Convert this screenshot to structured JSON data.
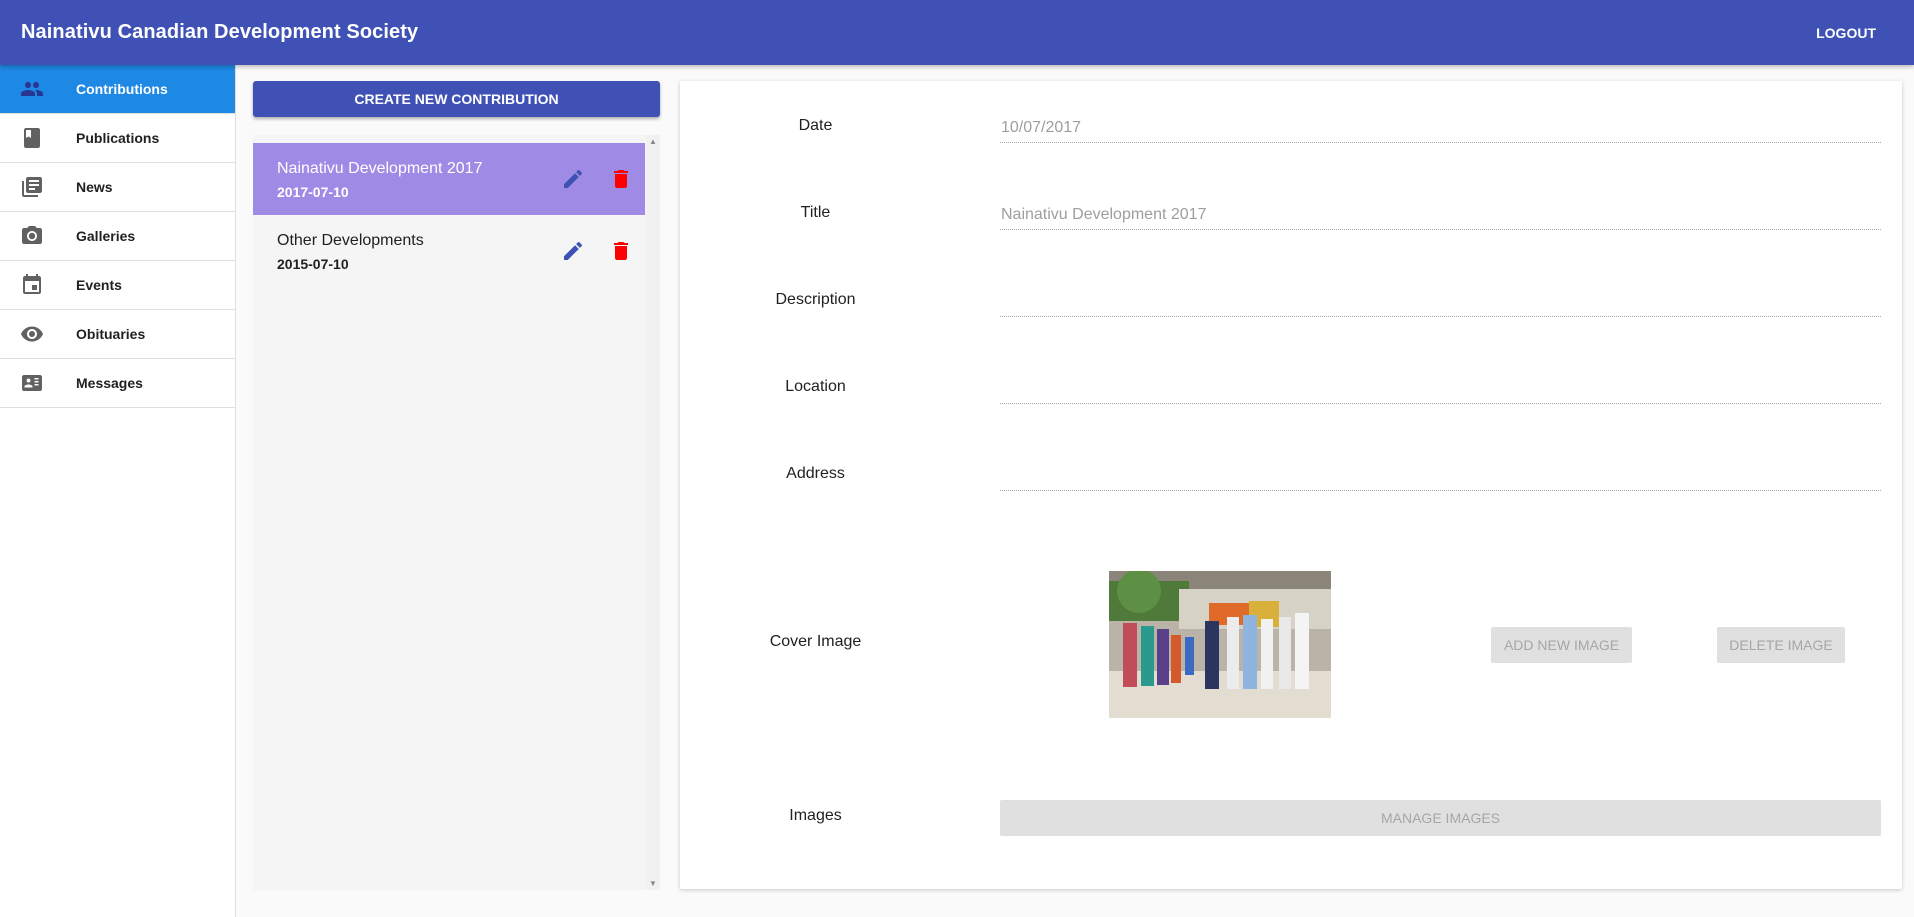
{
  "header": {
    "title": "Nainativu Canadian Development Society",
    "logout_label": "LOGOUT"
  },
  "sidebar": {
    "items": [
      {
        "label": "Contributions",
        "icon": "people-icon",
        "active": true
      },
      {
        "label": "Publications",
        "icon": "book-icon"
      },
      {
        "label": "News",
        "icon": "newspaper-icon"
      },
      {
        "label": "Galleries",
        "icon": "camera-icon"
      },
      {
        "label": "Events",
        "icon": "calendar-icon"
      },
      {
        "label": "Obituaries",
        "icon": "eye-icon"
      },
      {
        "label": "Messages",
        "icon": "contact-card-icon"
      }
    ]
  },
  "list": {
    "create_label": "CREATE NEW CONTRIBUTION",
    "items": [
      {
        "title": "Nainativu Development 2017",
        "date": "2017-07-10",
        "selected": true
      },
      {
        "title": "Other Developments",
        "date": "2015-07-10"
      }
    ]
  },
  "form": {
    "date": {
      "label": "Date",
      "value": "10/07/2017"
    },
    "title": {
      "label": "Title",
      "value": "Nainativu Development 2017"
    },
    "description": {
      "label": "Description",
      "value": ""
    },
    "location": {
      "label": "Location",
      "value": ""
    },
    "address": {
      "label": "Address",
      "value": ""
    },
    "cover_image": {
      "label": "Cover Image",
      "add_label": "ADD NEW IMAGE",
      "delete_label": "DELETE IMAGE"
    },
    "images": {
      "label": "Images",
      "manage_label": "MANAGE IMAGES"
    }
  },
  "colors": {
    "primary": "#3f51b5",
    "active_nav": "#1e88e5",
    "selected_item": "#9f8ae6",
    "edit_icon": "#3f51b5",
    "delete_icon": "#ff0000"
  }
}
